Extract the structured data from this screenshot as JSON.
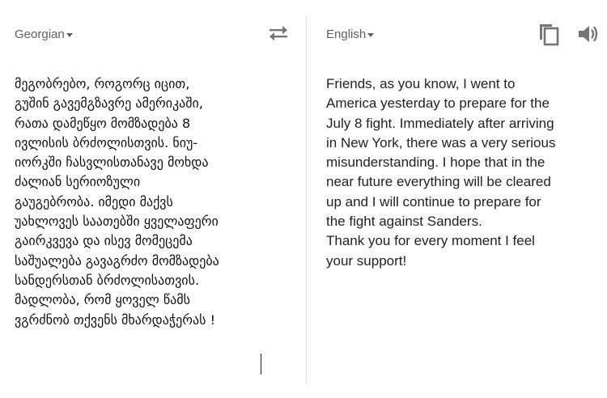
{
  "source": {
    "language": "Georgian",
    "text": "მეგობრებო, როგორც იცით,\nგუშინ გავემგზავრე ამერიკაში,\nრათა დამეწყო მომზადება 8\nივლისის ბრძოლისთვის. ნიუ-\nიორკში ჩასვლისთანავე მოხდა\nძალიან სერიოზული\nგაუგებრობა. იმედი მაქვს\nუახლოვეს საათებში ყველაფერი\nგაირკვევა და ისევ მომეცემა\nსაშუალება გავაგრძო მომზადება\nსანდერსთან ბრძოლისათვის.\nმადლობა, რომ ყოველ წამს\nვგრძნობ თქვენს მხარდაჭერას !"
  },
  "target": {
    "language": "English",
    "text": "Friends, as you know, I went to\nAmerica yesterday to prepare for the\nJuly 8 fight. Immediately after arriving\nin New York, there was a very serious\nmisunderstanding. I hope that in the\nnear future everything will be cleared\nup and I will continue to prepare for\nthe fight against Sanders.\nThank you for every moment I feel\nyour support!"
  },
  "icons": {
    "swap": "swap-languages-icon",
    "copy": "copy-icon",
    "listen": "speaker-icon"
  },
  "colors": {
    "icon": "#757575",
    "label": "#5f5f5f",
    "divider": "#e1e1e1"
  }
}
